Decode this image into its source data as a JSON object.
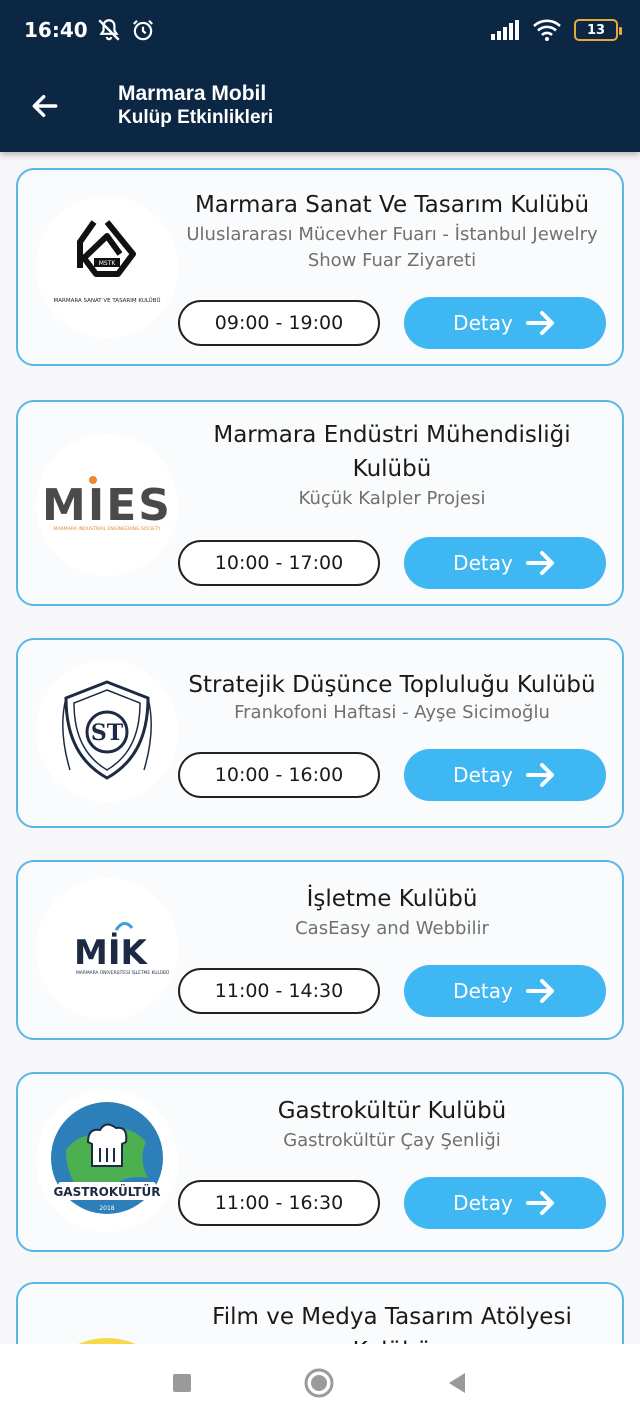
{
  "status": {
    "time": "16:40",
    "battery": "13"
  },
  "header": {
    "title_line1": "Marmara Mobil",
    "title_line2": "Kulüp Etkinlikleri"
  },
  "colors": {
    "header_bg": "#0c2744",
    "card_border": "#57b8e6",
    "button_bg": "#3fb7f3"
  },
  "events": [
    {
      "club": "Marmara Sanat Ve Tasarım Kulübü",
      "event": "Uluslararası Mücevher Fuarı - İstanbul Jewelry Show Fuar Ziyareti",
      "time": "09:00 - 19:00",
      "logo_text": "MARMARA SANAT VE TASARIM KULÜBÜ",
      "logo_mark": "MSTK"
    },
    {
      "club": "Marmara Endüstri Mühendisliği Kulübü",
      "event": "Küçük Kalpler Projesi",
      "time": "10:00 - 17:00",
      "logo_text": "MARMARA INDUSTRIAL ENGINEERING SOCIETY",
      "logo_mark": "MIES"
    },
    {
      "club": "Stratejik Düşünce Topluluğu Kulübü",
      "event": "Frankofoni Haftasi - Ayşe Sicimoğlu",
      "time": "10:00 - 16:00",
      "logo_mark": "ST"
    },
    {
      "club": "İşletme Kulübü",
      "event": "CasEasy and Webbilir",
      "time": "11:00 - 14:30",
      "logo_mark": "MİK",
      "logo_text": "MARMARA ÜNİVERSİTESİ İŞLETME KULÜBÜ"
    },
    {
      "club": "Gastrokültür Kulübü",
      "event": "Gastrokültür Çay Şenliği",
      "time": "11:00 - 16:30",
      "logo_mark": "GASTROKÜLTÜR",
      "logo_year": "2018"
    },
    {
      "club": "Film ve Medya Tasarım Atölyesi Kulübü"
    }
  ],
  "detail_label": "Detay"
}
